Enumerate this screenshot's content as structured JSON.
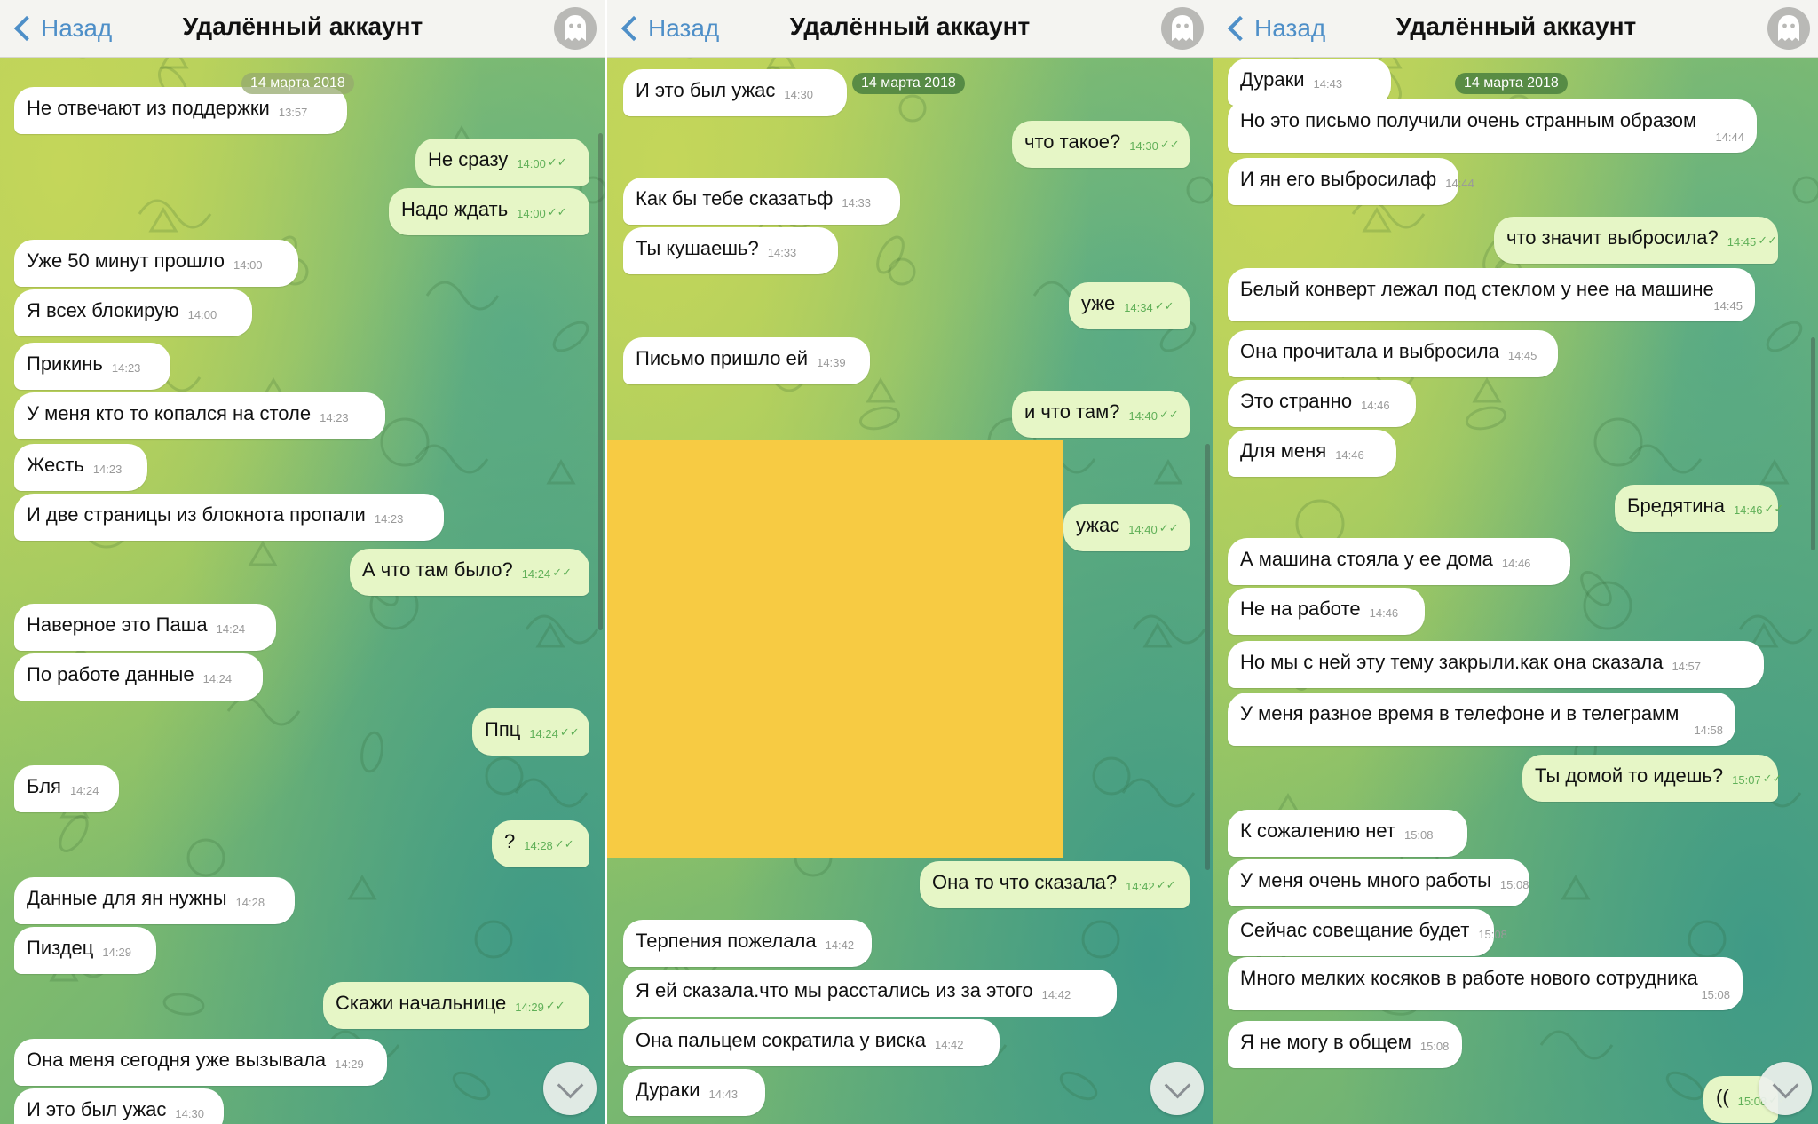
{
  "header": {
    "back_label": "Назад",
    "title": "Удалённый аккаунт"
  },
  "date_badge": "14 марта 2018",
  "panels": [
    {
      "messages": [
        {
          "dir": "in",
          "text": "Не отвечают из поддержки",
          "time": "13:57"
        },
        {
          "dir": "out",
          "text": "Не сразу",
          "time": "14:00"
        },
        {
          "dir": "out",
          "text": "Надо ждать",
          "time": "14:00"
        },
        {
          "dir": "in",
          "text": "Уже 50 минут прошло",
          "time": "14:00"
        },
        {
          "dir": "in",
          "text": "Я всех блокирую",
          "time": "14:00"
        },
        {
          "dir": "in",
          "text": "Прикинь",
          "time": "14:23"
        },
        {
          "dir": "in",
          "text": "У меня кто то копался на столе",
          "time": "14:23"
        },
        {
          "dir": "in",
          "text": "Жесть",
          "time": "14:23"
        },
        {
          "dir": "in",
          "text": "И две страницы из блокнота пропали",
          "time": "14:23"
        },
        {
          "dir": "out",
          "text": "А что там было?",
          "time": "14:24"
        },
        {
          "dir": "in",
          "text": "Наверное это Паша",
          "time": "14:24"
        },
        {
          "dir": "in",
          "text": "По работе данные",
          "time": "14:24"
        },
        {
          "dir": "out",
          "text": "Ппц",
          "time": "14:24"
        },
        {
          "dir": "in",
          "text": "Бля",
          "time": "14:24"
        },
        {
          "dir": "out",
          "text": "?",
          "time": "14:28"
        },
        {
          "dir": "in",
          "text": "Данные для ян нужны",
          "time": "14:28"
        },
        {
          "dir": "in",
          "text": "Пиздец",
          "time": "14:29"
        },
        {
          "dir": "out",
          "text": "Скажи начальнице",
          "time": "14:29"
        },
        {
          "dir": "in",
          "text": "Она меня сегодня уже вызывала",
          "time": "14:29"
        },
        {
          "dir": "in",
          "text": "И это был ужас",
          "time": "14:30"
        }
      ]
    },
    {
      "messages": [
        {
          "dir": "in",
          "text": "И это был ужас",
          "time": "14:30"
        },
        {
          "dir": "out",
          "text": "что такое?",
          "time": "14:30"
        },
        {
          "dir": "in",
          "text": "Как бы тебе сказатьф",
          "time": "14:33"
        },
        {
          "dir": "in",
          "text": "Ты кушаешь?",
          "time": "14:33"
        },
        {
          "dir": "out",
          "text": "уже",
          "time": "14:34"
        },
        {
          "dir": "in",
          "text": "Письмо пришло ей",
          "time": "14:39"
        },
        {
          "dir": "out",
          "text": "и что там?",
          "time": "14:40"
        },
        {
          "dir": "out",
          "text": "ужас",
          "time": "14:40"
        },
        {
          "dir": "out",
          "text": "Она то что сказала?",
          "time": "14:42"
        },
        {
          "dir": "in",
          "text": "Терпения пожелала",
          "time": "14:42"
        },
        {
          "dir": "in",
          "text": "Я ей сказала.что мы расстались из за этого",
          "time": "14:42"
        },
        {
          "dir": "in",
          "text": "Она пальцем сократила у виска",
          "time": "14:42"
        },
        {
          "dir": "in",
          "text": "Дураки",
          "time": "14:43"
        }
      ]
    },
    {
      "messages": [
        {
          "dir": "in",
          "text": "Дураки",
          "time": "14:43"
        },
        {
          "dir": "in",
          "text": "Но это письмо получили очень странным образом",
          "time": "14:44"
        },
        {
          "dir": "in",
          "text": "И ян его выбросилаф",
          "time": "14:44"
        },
        {
          "dir": "out",
          "text": "что значит выбросила?",
          "time": "14:45"
        },
        {
          "dir": "in",
          "text": "Белый конверт лежал под стеклом у нее на машине",
          "time": "14:45"
        },
        {
          "dir": "in",
          "text": "Она прочитала и выбросила",
          "time": "14:45"
        },
        {
          "dir": "in",
          "text": "Это странно",
          "time": "14:46"
        },
        {
          "dir": "in",
          "text": "Для меня",
          "time": "14:46"
        },
        {
          "dir": "out",
          "text": "Бредятина",
          "time": "14:46"
        },
        {
          "dir": "in",
          "text": "А машина стояла у ее дома",
          "time": "14:46"
        },
        {
          "dir": "in",
          "text": "Не на работе",
          "time": "14:46"
        },
        {
          "dir": "in",
          "text": "Но мы с ней эту тему закрыли.как она сказала",
          "time": "14:57"
        },
        {
          "dir": "in",
          "text": "У меня разное время в телефоне и в телеграмм",
          "time": "14:58"
        },
        {
          "dir": "out",
          "text": "Ты домой то идешь?",
          "time": "15:07"
        },
        {
          "dir": "in",
          "text": "К сожалению нет",
          "time": "15:08"
        },
        {
          "dir": "in",
          "text": "У меня очень много работы",
          "time": "15:08"
        },
        {
          "dir": "in",
          "text": "Сейчас совещание будет",
          "time": "15:08"
        },
        {
          "dir": "in",
          "text": "Много мелких косяков в работе нового сотрудника",
          "time": "15:08"
        },
        {
          "dir": "in",
          "text": "Я не могу в общем",
          "time": "15:08"
        },
        {
          "dir": "out",
          "text": "((",
          "time": "15:08"
        }
      ]
    }
  ],
  "icons": {
    "back": "chevron-left-icon",
    "avatar": "ghost-icon",
    "scroll": "chevron-down-icon",
    "read": "double-check-icon"
  },
  "colors": {
    "accent": "#4e8fc8",
    "outgoing_bubble": "#e6f6c6",
    "incoming_bubble": "#ffffff",
    "read_check": "#60b058",
    "media_placeholder": "#f7cb43"
  }
}
